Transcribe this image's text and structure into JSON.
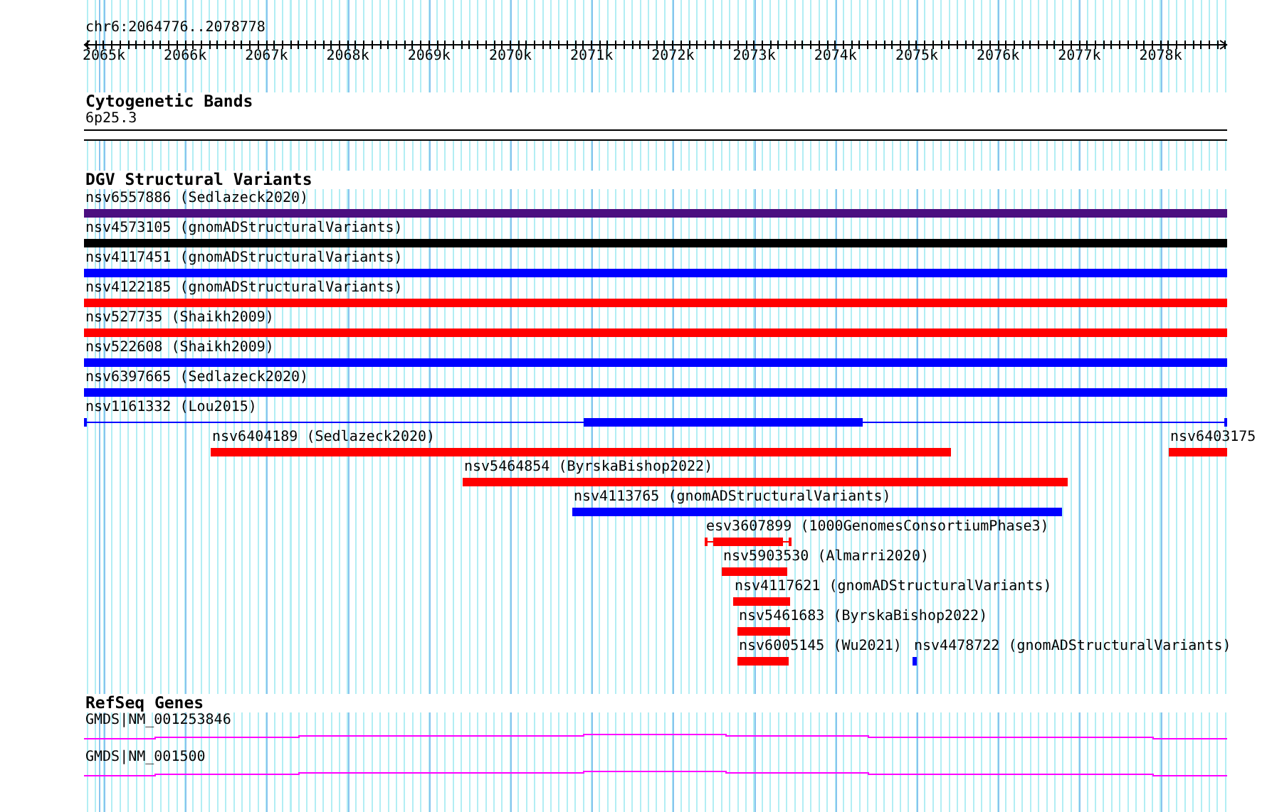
{
  "ruler": {
    "location": "chr6:2064776..2078778",
    "ticks": [
      "2065k",
      "2066k",
      "2067k",
      "2068k",
      "2069k",
      "2070k",
      "2071k",
      "2072k",
      "2073k",
      "2074k",
      "2075k",
      "2076k",
      "2077k",
      "2078k"
    ]
  },
  "tracks": [
    {
      "kind": "bands",
      "title": "Cytogenetic Bands",
      "features": [
        {
          "label": "6p25.3"
        }
      ]
    },
    {
      "kind": "variants",
      "title": "DGV Structural Variants",
      "features": [
        {
          "label": "nsv6557886 (Sedlazeck2020)",
          "color": "#4b0f80",
          "kind": "bar"
        },
        {
          "label": "nsv4573105 (gnomADStructuralVariants)",
          "color": "#000000",
          "kind": "bar"
        },
        {
          "label": "nsv4117451 (gnomADStructuralVariants)",
          "color": "#0000ff",
          "kind": "bar"
        },
        {
          "label": "nsv4122185 (gnomADStructuralVariants)",
          "color": "#ff0000",
          "kind": "bar"
        },
        {
          "label": "nsv527735 (Shaikh2009)",
          "color": "#ff0000",
          "kind": "bar"
        },
        {
          "label": "nsv522608 (Shaikh2009)",
          "color": "#0000ff",
          "kind": "bar"
        },
        {
          "label": "nsv6397665 (Sedlazeck2020)",
          "color": "#0000ff",
          "kind": "bar"
        },
        {
          "label": "nsv1161332 (Lou2015)",
          "color": "#0000ff",
          "kind": "split"
        },
        {
          "label": "nsv6404189 (Sedlazeck2020)",
          "color": "#ff0000",
          "kind": "bar"
        },
        {
          "label": "nsv6403175",
          "color": "#ff0000",
          "kind": "bar"
        },
        {
          "label": "nsv5464854 (ByrskaBishop2022)",
          "color": "#ff0000",
          "kind": "bar"
        },
        {
          "label": "nsv4113765 (gnomADStructuralVariants)",
          "color": "#0000ff",
          "kind": "bar"
        },
        {
          "label": "esv3607899 (1000GenomesConsortiumPhase3)",
          "color": "#ff0000",
          "kind": "interval"
        },
        {
          "label": "nsv5903530 (Almarri2020)",
          "color": "#ff0000",
          "kind": "bar"
        },
        {
          "label": "nsv4117621 (gnomADStructuralVariants)",
          "color": "#ff0000",
          "kind": "bar"
        },
        {
          "label": "nsv5461683 (ByrskaBishop2022)",
          "color": "#ff0000",
          "kind": "bar"
        },
        {
          "label": "nsv6005145 (Wu2021)",
          "color": "#ff0000",
          "kind": "bar"
        },
        {
          "label": "nsv4478722 (gnomADStructuralVariants)",
          "color": "#0000ff",
          "kind": "bar"
        }
      ]
    },
    {
      "kind": "genes",
      "title": "RefSeq Genes",
      "features": [
        {
          "label": "GMDS|NM_001253846"
        },
        {
          "label": "GMDS|NM_001500"
        }
      ]
    }
  ]
}
